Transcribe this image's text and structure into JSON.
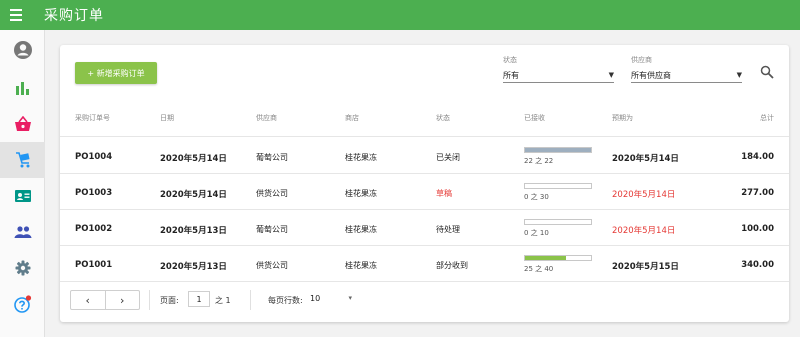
{
  "app": {
    "title": "采购订单"
  },
  "sidebar": {
    "items": [
      {
        "name": "account-icon",
        "color": "#777777",
        "active": false
      },
      {
        "name": "bar-chart-icon",
        "color": "#4caf50",
        "active": false
      },
      {
        "name": "basket-icon",
        "color": "#e91e63",
        "active": false
      },
      {
        "name": "cart-icon",
        "color": "#2196f3",
        "active": true
      },
      {
        "name": "contact-card-icon",
        "color": "#009688",
        "active": false
      },
      {
        "name": "people-icon",
        "color": "#3f51b5",
        "active": false
      },
      {
        "name": "gear-icon",
        "color": "#607d8b",
        "active": false
      },
      {
        "name": "help-icon",
        "color": "#2196f3",
        "active": false
      }
    ]
  },
  "toolbar": {
    "add_label": "+ 新增采购订单",
    "status_label": "状态",
    "status_value": "所有",
    "supplier_label": "供应商",
    "supplier_value": "所有供应商",
    "search_icon": "search-icon"
  },
  "table": {
    "headers": {
      "order_no": "采购订单号",
      "date": "日期",
      "supplier": "供应商",
      "store": "商店",
      "status": "状态",
      "received": "已接收",
      "expected": "预期为",
      "total": "总计"
    },
    "rows": [
      {
        "order_no": "PO1004",
        "date": "2020年5月14日",
        "supplier": "葡萄公司",
        "store": "桂花果冻",
        "status": "已关闭",
        "status_red": false,
        "received_text": "22 之 22",
        "received_fraction": 1.0,
        "bar_color": "#9eafbf",
        "expected": "2020年5月14日",
        "expected_red": false,
        "total": "184.00"
      },
      {
        "order_no": "PO1003",
        "date": "2020年5月14日",
        "supplier": "供货公司",
        "store": "桂花果冻",
        "status": "草稿",
        "status_red": true,
        "received_text": "0 之 30",
        "received_fraction": 0.0,
        "bar_color": "#9eafbf",
        "expected": "2020年5月14日",
        "expected_red": true,
        "total": "277.00"
      },
      {
        "order_no": "PO1002",
        "date": "2020年5月13日",
        "supplier": "葡萄公司",
        "store": "桂花果冻",
        "status": "待处理",
        "status_red": false,
        "received_text": "0 之 10",
        "received_fraction": 0.0,
        "bar_color": "#9eafbf",
        "expected": "2020年5月14日",
        "expected_red": true,
        "total": "100.00"
      },
      {
        "order_no": "PO1001",
        "date": "2020年5月13日",
        "supplier": "供货公司",
        "store": "桂花果冻",
        "status": "部分收到",
        "status_red": false,
        "received_text": "25 之 40",
        "received_fraction": 0.625,
        "bar_color": "#8bc34a",
        "expected": "2020年5月15日",
        "expected_red": false,
        "total": "340.00"
      }
    ]
  },
  "footer": {
    "prev": "‹",
    "next": "›",
    "page_label": "页面:",
    "page_value": "1",
    "of_label": "之 1",
    "rows_label": "每页行数:",
    "rows_value": "10",
    "rows_arrow": "▾"
  },
  "colors": {
    "accent_green": "#4caf50",
    "button_green": "#8bc34a",
    "danger_red": "#e53935"
  }
}
